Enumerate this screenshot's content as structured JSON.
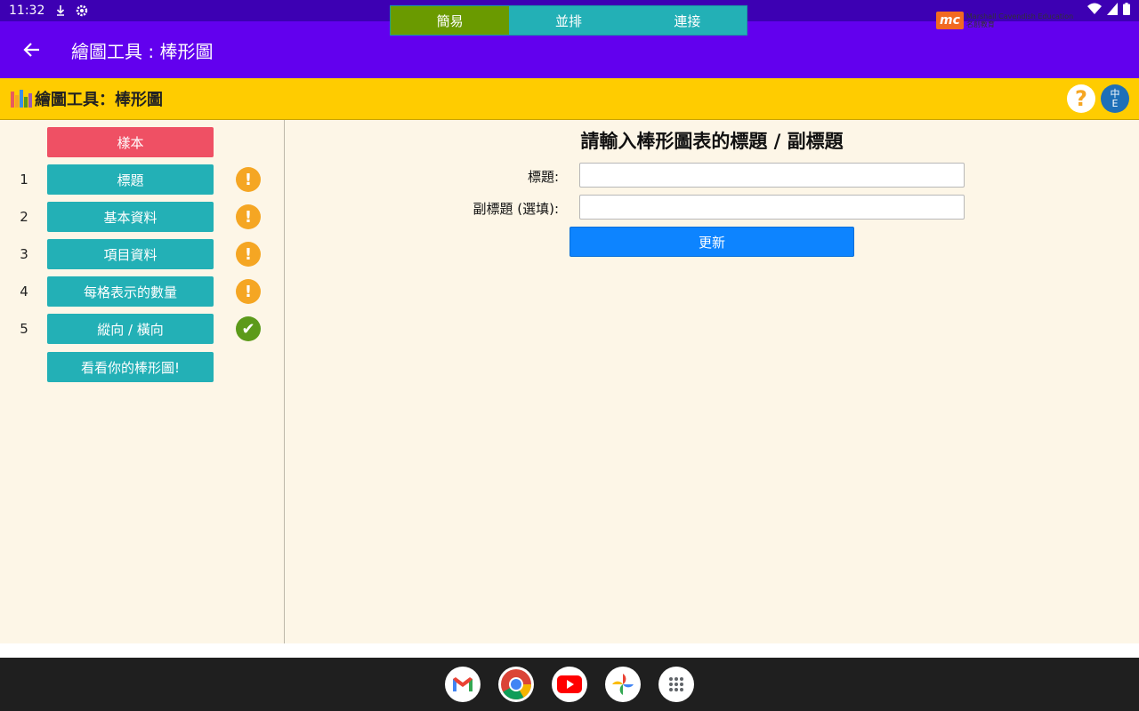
{
  "status_bar": {
    "time": "11:32"
  },
  "app_bar": {
    "title": "繪圖工具 : 棒形圖"
  },
  "toolbar": {
    "logo_text": "繪圖工具：棒形圖",
    "modes": [
      "簡易",
      "並排",
      "連接"
    ],
    "active_mode": "簡易",
    "brand_mark": "mc",
    "brand_name_en": "Marshall Cavendish Education",
    "brand_name_zh": "名創教育",
    "help_label": "?",
    "lang_zh": "中",
    "lang_en": "E"
  },
  "sidebar": {
    "sample_label": "樣本",
    "steps": [
      {
        "num": "1",
        "label": "標題",
        "status": "warning"
      },
      {
        "num": "2",
        "label": "基本資料",
        "status": "warning"
      },
      {
        "num": "3",
        "label": "項目資料",
        "status": "warning"
      },
      {
        "num": "4",
        "label": "每格表示的數量",
        "status": "warning"
      },
      {
        "num": "5",
        "label": "縱向 / 橫向",
        "status": "done"
      }
    ],
    "view_label": "看看你的棒形圖!",
    "warning_glyph": "!",
    "done_glyph": "✔"
  },
  "main": {
    "heading": "請輸入棒形圖表的標題 / 副標題",
    "title_label": "標題:",
    "title_value": "",
    "subtitle_label": "副標題 (選填):",
    "subtitle_value": "",
    "update_label": "更新"
  },
  "dock": {
    "apps": [
      "gmail-icon",
      "chrome-icon",
      "youtube-icon",
      "photos-icon",
      "app-drawer-icon"
    ]
  },
  "colors": {
    "status_bar": "#3d00b3",
    "app_bar": "#6200ee",
    "toolbar": "#ffcc00",
    "mode_active": "#6a9a00",
    "mode_inactive": "#23b0b6",
    "sample": "#ef5064",
    "step": "#23b0b6",
    "warning": "#f5a623",
    "done": "#5c9a1a",
    "update": "#0d84ff",
    "panel_bg": "#fdf6e7"
  }
}
